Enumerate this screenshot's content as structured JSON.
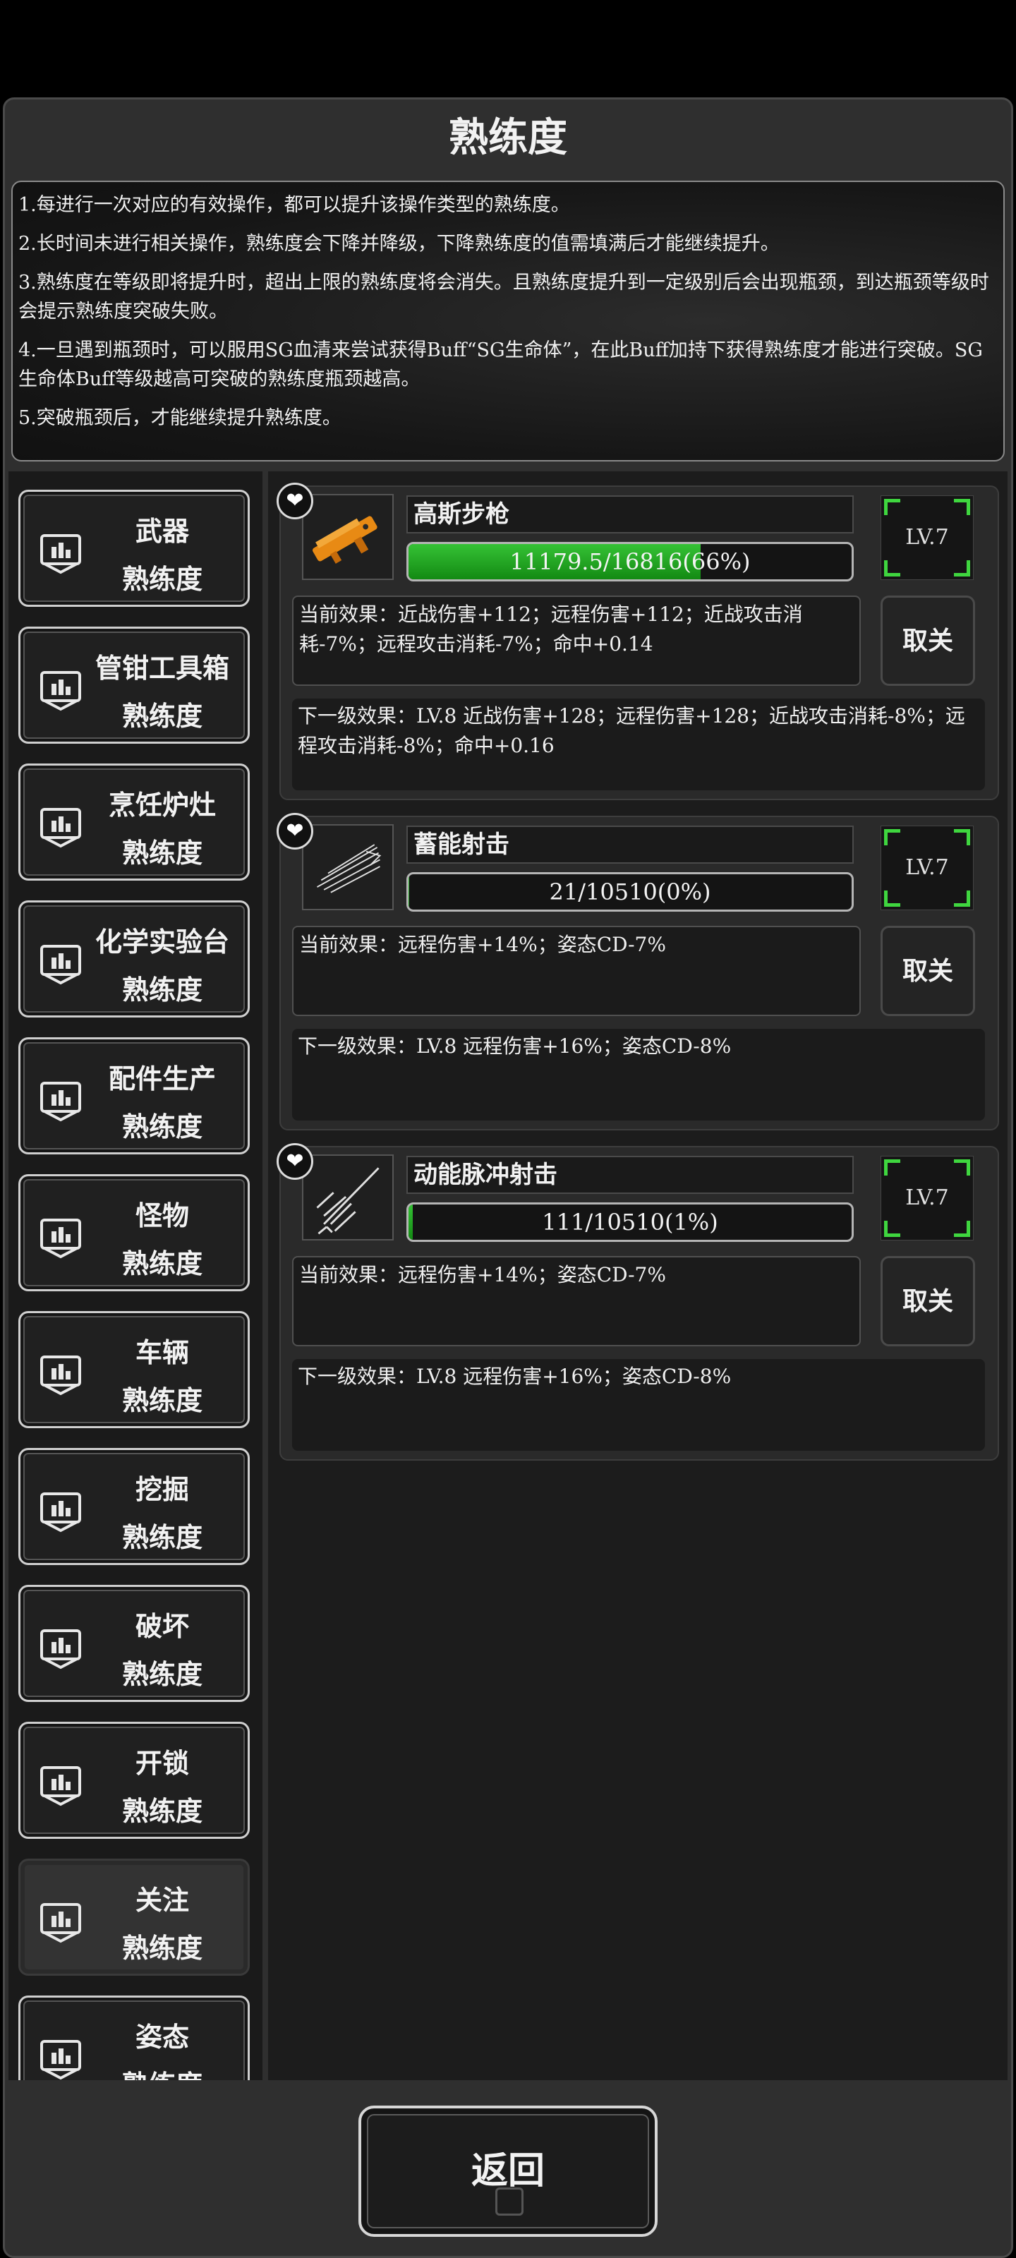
{
  "title": "熟练度",
  "rules": [
    "1.每进行一次对应的有效操作，都可以提升该操作类型的熟练度。",
    "2.长时间未进行相关操作，熟练度会下降并降级，下降熟练度的值需填满后才能继续提升。",
    "3.熟练度在等级即将提升时，超出上限的熟练度将会消失。且熟练度提升到一定级别后会出现瓶颈，到达瓶颈等级时会提示熟练度突破失败。",
    "4.一旦遇到瓶颈时，可以服用SG血清来尝试获得Buff“SG生命体”，在此Buff加持下获得熟练度才能进行突破。SG生命体Buff等级越高可突破的熟练度瓶颈越高。",
    "5.突破瓶颈后，才能继续提升熟练度。"
  ],
  "categories": [
    {
      "line1": "武器",
      "line2": "熟练度"
    },
    {
      "line1": "管钳工具箱",
      "line2": "熟练度"
    },
    {
      "line1": "烹饪炉灶",
      "line2": "熟练度"
    },
    {
      "line1": "化学实验台",
      "line2": "熟练度"
    },
    {
      "line1": "配件生产",
      "line2": "熟练度"
    },
    {
      "line1": "怪物",
      "line2": "熟练度"
    },
    {
      "line1": "车辆",
      "line2": "熟练度"
    },
    {
      "line1": "挖掘",
      "line2": "熟练度"
    },
    {
      "line1": "破坏",
      "line2": "熟练度"
    },
    {
      "line1": "开锁",
      "line2": "熟练度"
    },
    {
      "line1": "关注",
      "line2": "熟练度"
    },
    {
      "line1": "姿态",
      "line2": "熟练度"
    }
  ],
  "active_category": "关注",
  "skills": [
    {
      "name": "高斯步枪",
      "progress_text": "11179.5/16816(66%)",
      "progress": 0.66,
      "level": "LV.7",
      "current_effect": "当前效果：近战伤害+112；远程伤害+112；近战攻击消耗-7%；远程攻击消耗-7%；命中+0.14",
      "button": "取关",
      "next_effect": "下一级效果：LV.8 近战伤害+128；远程伤害+128；近战攻击消耗-8%；远程攻击消耗-8%；命中+0.16",
      "heart": "❤"
    },
    {
      "name": "蓄能射击",
      "progress_text": "21/10510(0%)",
      "progress": 0.002,
      "level": "LV.7",
      "current_effect": "当前效果：远程伤害+14%；姿态CD-7%",
      "button": "取关",
      "next_effect": "下一级效果：LV.8 远程伤害+16%；姿态CD-8%",
      "heart": "❤"
    },
    {
      "name": "动能脉冲射击",
      "progress_text": "111/10510(1%)",
      "progress": 0.01,
      "level": "LV.7",
      "current_effect": "当前效果：远程伤害+14%；姿态CD-7%",
      "button": "取关",
      "next_effect": "下一级效果：LV.8 远程伤害+16%；姿态CD-8%",
      "heart": "❤"
    }
  ],
  "back_label": "返回",
  "colors": {
    "progress_green": "#2aa82a",
    "level_corner": "#3fd63f",
    "background": "#2f2f2f"
  }
}
